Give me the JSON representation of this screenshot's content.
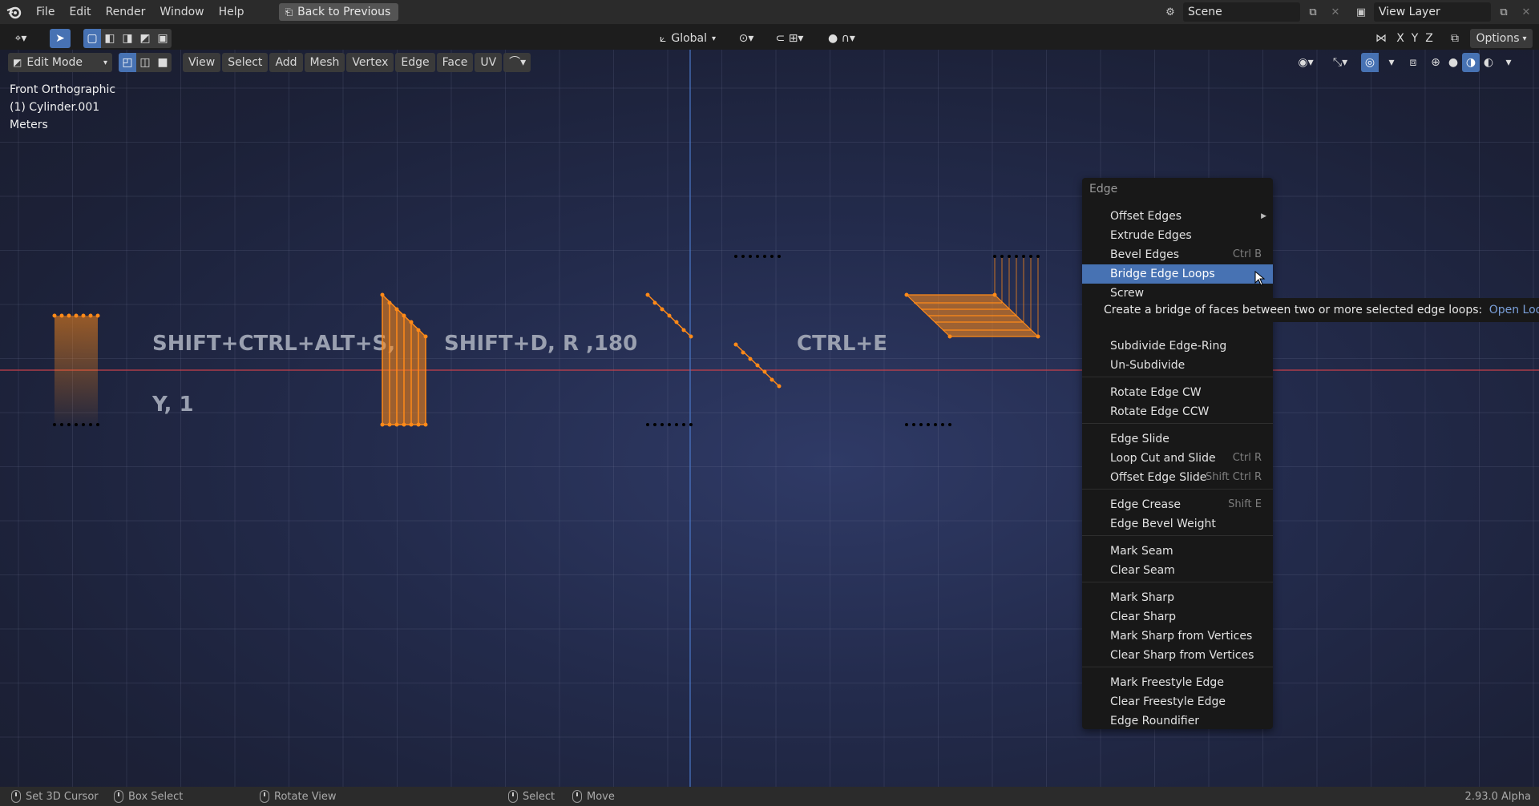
{
  "topbar": {
    "menus": [
      "File",
      "Edit",
      "Render",
      "Window",
      "Help"
    ],
    "back_button": "Back to Previous",
    "scene_label": "Scene",
    "view_layer_label": "View Layer"
  },
  "toolbar1": {
    "orientation": "Global",
    "axes": [
      "X",
      "Y",
      "Z"
    ],
    "options": "Options"
  },
  "toolbar2": {
    "mode": "Edit Mode",
    "menus": [
      "View",
      "Select",
      "Add",
      "Mesh",
      "Vertex",
      "Edge",
      "Face",
      "UV"
    ]
  },
  "viewport": {
    "view_name": "Front Orthographic",
    "object_name": "(1) Cylinder.001",
    "units": "Meters",
    "hint1": "SHIFT+CTRL+ALT+S,",
    "hint2": "Y, 1",
    "hint3": "SHIFT+D, R ,180",
    "hint4": "CTRL+E"
  },
  "context_menu": {
    "title": "Edge",
    "items": [
      {
        "label": "Offset Edges",
        "shortcut": "",
        "submenu": true
      },
      {
        "label": "Extrude Edges",
        "shortcut": ""
      },
      {
        "label": "Bevel Edges",
        "shortcut": "Ctrl B"
      },
      {
        "label": "Bridge Edge Loops",
        "shortcut": "",
        "highlighted": true
      },
      {
        "label": "Screw",
        "shortcut": ""
      },
      {
        "label": "Subdivide Edge-Ring",
        "shortcut": ""
      },
      {
        "label": "Un-Subdivide",
        "shortcut": ""
      },
      {
        "label": "Rotate Edge CW",
        "shortcut": ""
      },
      {
        "label": "Rotate Edge CCW",
        "shortcut": ""
      },
      {
        "label": "Edge Slide",
        "shortcut": ""
      },
      {
        "label": "Loop Cut and Slide",
        "shortcut": "Ctrl R"
      },
      {
        "label": "Offset Edge Slide",
        "shortcut": "Shift Ctrl R"
      },
      {
        "label": "Edge Crease",
        "shortcut": "Shift E"
      },
      {
        "label": "Edge Bevel Weight",
        "shortcut": ""
      },
      {
        "label": "Mark Seam",
        "shortcut": ""
      },
      {
        "label": "Clear Seam",
        "shortcut": ""
      },
      {
        "label": "Mark Sharp",
        "shortcut": ""
      },
      {
        "label": "Clear Sharp",
        "shortcut": ""
      },
      {
        "label": "Mark Sharp from Vertices",
        "shortcut": ""
      },
      {
        "label": "Clear Sharp from Vertices",
        "shortcut": ""
      },
      {
        "label": "Mark Freestyle Edge",
        "shortcut": ""
      },
      {
        "label": "Clear Freestyle Edge",
        "shortcut": ""
      },
      {
        "label": "Edge Roundifier",
        "shortcut": ""
      }
    ]
  },
  "tooltip": {
    "text": "Create a bridge of faces between two or more selected edge loops:",
    "python": "Open Loop"
  },
  "statusbar": {
    "set_cursor": "Set 3D Cursor",
    "box_select": "Box Select",
    "rotate_view": "Rotate View",
    "select": "Select",
    "move": "Move",
    "version": "2.93.0 Alpha"
  },
  "colors": {
    "accent": "#4772b3",
    "selection_orange": "#ff8a18",
    "x_axis": "#c8404a",
    "z_axis": "#4a78c8"
  }
}
